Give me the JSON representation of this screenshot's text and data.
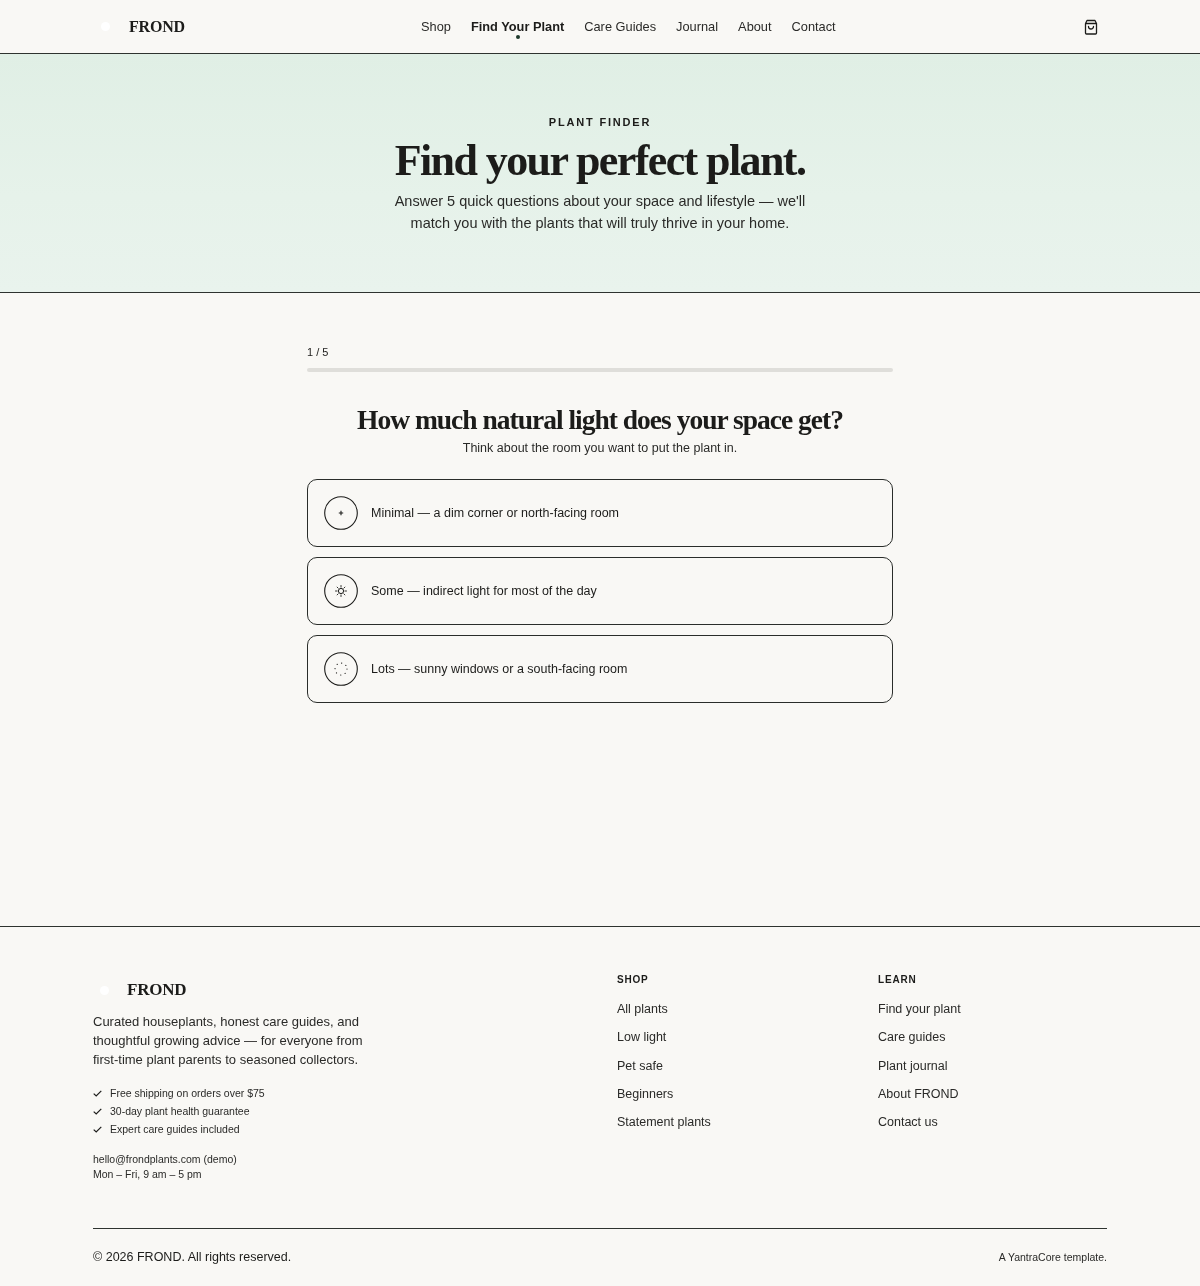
{
  "header": {
    "logo": "FROND",
    "nav": [
      {
        "label": "Shop",
        "selected": false
      },
      {
        "label": "Find Your Plant",
        "selected": true
      },
      {
        "label": "Care Guides",
        "selected": false
      },
      {
        "label": "Journal",
        "selected": false
      },
      {
        "label": "About",
        "selected": false
      },
      {
        "label": "Contact",
        "selected": false
      }
    ]
  },
  "hero": {
    "eyebrow": "PLANT FINDER",
    "title": "Find your perfect plant.",
    "subtitle": "Answer 5 quick questions about your space and lifestyle — we'll match you with the plants that will truly thrive in your home."
  },
  "quiz": {
    "step": "1 / 5",
    "question": "How much natural light does your space get?",
    "hint": "Think about the room you want to put the plant in.",
    "options": [
      {
        "kind": "low",
        "label": "Minimal — a dim corner or north-facing room",
        "selected": false
      },
      {
        "kind": "medium",
        "label": "Some — indirect light for most of the day",
        "selected": false
      },
      {
        "kind": "high",
        "label": "Lots — sunny windows or a south-facing room",
        "selected": false
      }
    ]
  },
  "footer": {
    "logo": "FROND",
    "description": "Curated houseplants, honest care guides, and thoughtful growing advice — for everyone from first-time plant parents to seasoned collectors.",
    "perks": [
      "Free shipping on orders over $75",
      "30-day plant health guarantee",
      "Expert care guides included"
    ],
    "email": "hello@frondplants.com (demo)",
    "hours": "Mon – Fri, 9 am – 5 pm",
    "columns": [
      {
        "heading": "SHOP",
        "links": [
          "All plants",
          "Low light",
          "Pet safe",
          "Beginners",
          "Statement plants"
        ]
      },
      {
        "heading": "LEARN",
        "links": [
          "Find your plant",
          "Care guides",
          "Plant journal",
          "About FROND",
          "Contact us"
        ]
      }
    ],
    "copyright": "© 2026 FROND. All rights reserved.",
    "credit": "A YantraCore template."
  }
}
